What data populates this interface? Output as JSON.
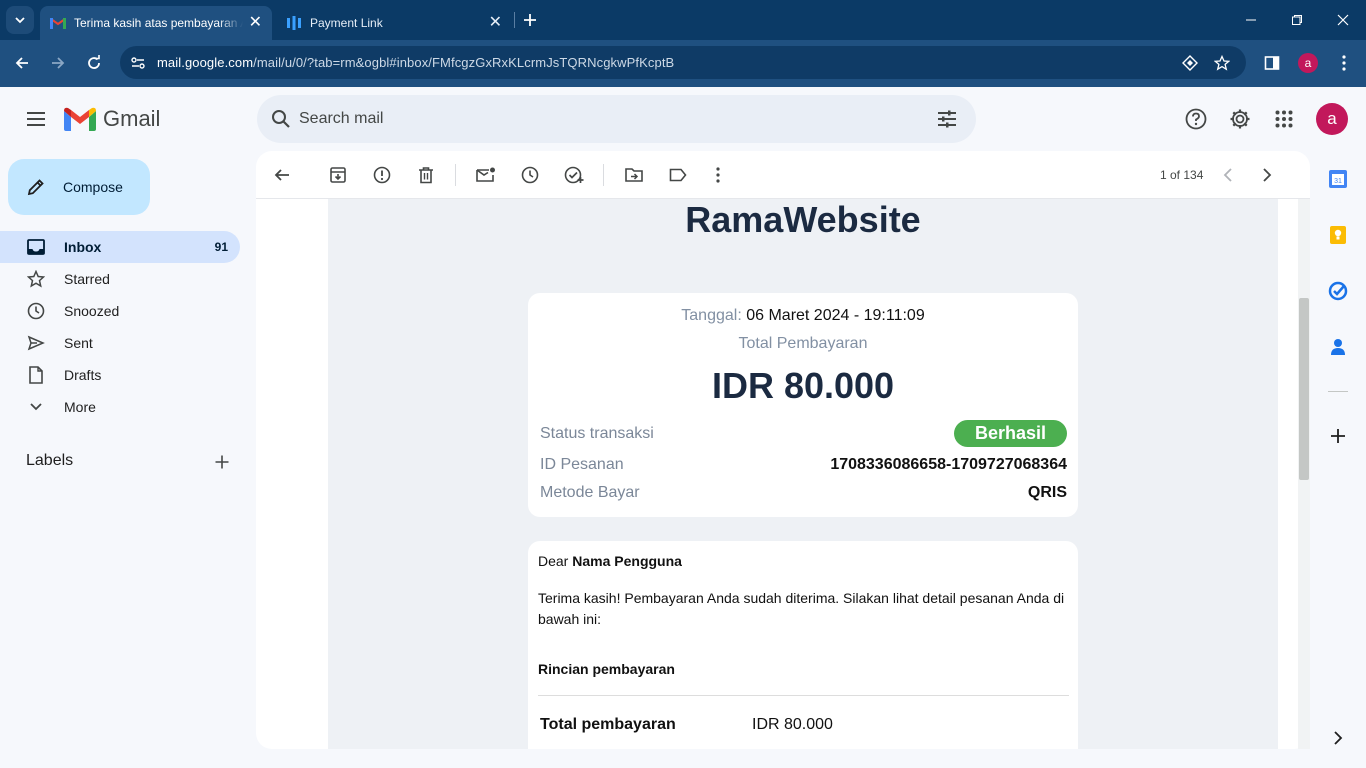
{
  "browser": {
    "tabs": [
      {
        "title": "Terima kasih atas pembayaran Anda",
        "active": true
      },
      {
        "title": "Payment Link",
        "active": false
      }
    ],
    "url_host": "mail.google.com",
    "url_path": "/mail/u/0/?tab=rm&ogbl#inbox/FMfcgzGxRxKLcrmJsTQRNcgkwPfKcptB",
    "profile_initial": "a"
  },
  "gmail": {
    "logo_text": "Gmail",
    "search_placeholder": "Search mail",
    "avatar_initial": "a",
    "compose_label": "Compose",
    "nav": [
      {
        "label": "Inbox",
        "count": "91",
        "icon": "inbox-icon"
      },
      {
        "label": "Starred",
        "count": "",
        "icon": "star-icon"
      },
      {
        "label": "Snoozed",
        "count": "",
        "icon": "clock-icon"
      },
      {
        "label": "Sent",
        "count": "",
        "icon": "send-icon"
      },
      {
        "label": "Drafts",
        "count": "",
        "icon": "draft-icon"
      },
      {
        "label": "More",
        "count": "",
        "icon": "chevron-down-icon"
      }
    ],
    "labels_heading": "Labels",
    "pager": "1 of 134"
  },
  "email": {
    "brand": "RamaWebsite",
    "date_label": "Tanggal:",
    "date_value": "06 Maret 2024 - 19:11:09",
    "total_label": "Total Pembayaran",
    "total_amount": "IDR 80.000",
    "rows": [
      {
        "label": "Status transaksi",
        "value": "Berhasil"
      },
      {
        "label": "ID Pesanan",
        "value": "1708336086658-1709727068364"
      },
      {
        "label": "Metode Bayar",
        "value": "QRIS"
      }
    ],
    "dear": "Dear",
    "recipient": "Nama Pengguna",
    "message": "Terima kasih! Pembayaran Anda sudah diterima. Silakan lihat detail pesanan Anda di bawah ini:",
    "details_heading": "Rincian pembayaran",
    "total_payment_label": "Total pembayaran",
    "total_payment_value": "IDR 80.000"
  },
  "colors": {
    "chrome_dark": "#0b3a66",
    "chrome_toolbar": "#1f5080",
    "compose_bg": "#c2e7ff",
    "inbox_active_bg": "#d3e3fd",
    "success_badge": "#4caf50",
    "brand_text": "#1b2a41"
  }
}
